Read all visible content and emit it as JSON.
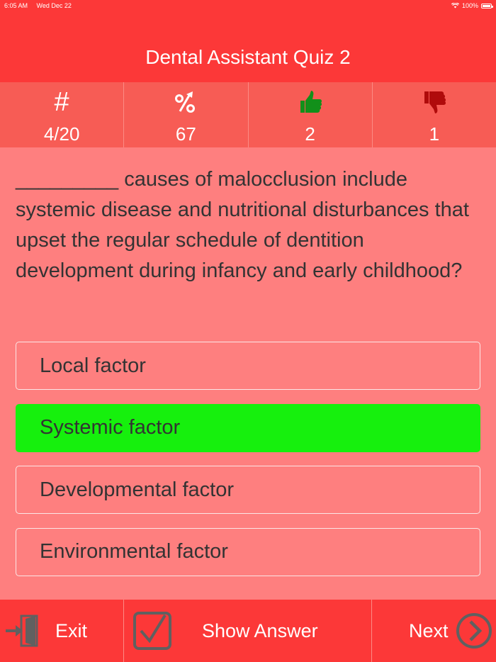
{
  "status_bar": {
    "time": "6:05 AM",
    "date": "Wed Dec 22",
    "battery": "100%"
  },
  "header": {
    "title": "Dental Assistant Quiz 2"
  },
  "stats": [
    {
      "icon": "hash-icon",
      "symbol": "#",
      "value": "4/20"
    },
    {
      "icon": "percent-icon",
      "value": "67"
    },
    {
      "icon": "thumbs-up-icon",
      "value": "2"
    },
    {
      "icon": "thumbs-down-icon",
      "value": "1"
    }
  ],
  "question": "_________ causes of malocclusion include systemic disease and nutritional disturbances that upset the regular schedule of dentition development during infancy and early childhood?",
  "options": [
    {
      "label": "Local factor",
      "state": "normal"
    },
    {
      "label": "Systemic factor",
      "state": "correct"
    },
    {
      "label": "Developmental factor",
      "state": "normal"
    },
    {
      "label": "Environmental factor",
      "state": "normal"
    }
  ],
  "footer": {
    "exit_label": "Exit",
    "show_answer_label": "Show Answer",
    "next_label": "Next"
  },
  "colors": {
    "header_bg": "#fc3838",
    "stats_bg": "#f75c55",
    "body_bg": "#fe7f7f",
    "correct": "#16f00d",
    "thumbs_up": "#12901a",
    "thumbs_down": "#b00b0b",
    "icon_gray": "#606060"
  }
}
